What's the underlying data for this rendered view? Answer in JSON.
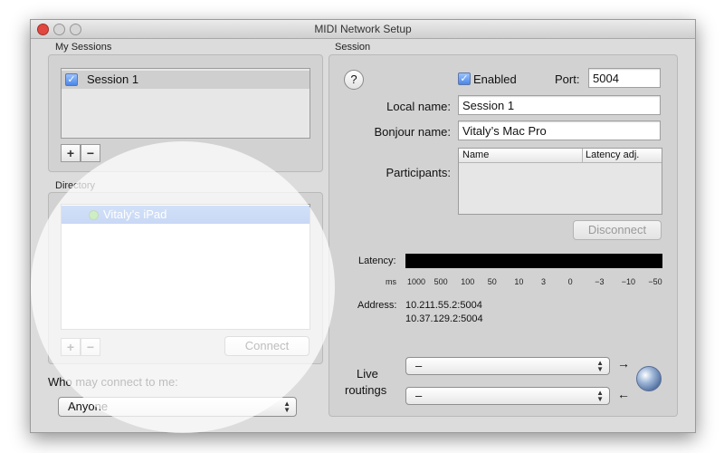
{
  "window": {
    "title": "MIDI Network Setup"
  },
  "my_sessions": {
    "label": "My Sessions",
    "items": [
      {
        "label": "Session 1",
        "checked": true
      }
    ],
    "add_label": "+",
    "remove_label": "−"
  },
  "directory": {
    "label": "Directory",
    "items": [
      {
        "label": "Vitaly’s iPad",
        "status_color": "#4fc02a"
      }
    ],
    "add_label": "+",
    "remove_label": "−",
    "connect_label": "Connect"
  },
  "who_may_connect": {
    "label": "Who may connect to me:",
    "selected": "Anyone"
  },
  "session": {
    "label": "Session",
    "help_label": "?",
    "enabled_label": "Enabled",
    "enabled": true,
    "port_label": "Port:",
    "port_value": "5004",
    "local_name_label": "Local name:",
    "local_name_value": "Session 1",
    "bonjour_name_label": "Bonjour name:",
    "bonjour_name_value": "Vitaly’s Mac Pro",
    "participants_label": "Participants:",
    "participants_columns": [
      "Name",
      "Latency adj."
    ],
    "disconnect_label": "Disconnect",
    "latency_label": "Latency:",
    "latency_unit": "ms",
    "latency_ticks": [
      "1000",
      "500",
      "100",
      "50",
      "10",
      "3",
      "0",
      "−3",
      "−10",
      "−50"
    ],
    "address_label": "Address:",
    "addresses": [
      "10.211.55.2:5004",
      "10.37.129.2:5004"
    ],
    "live_routings_label_1": "Live",
    "live_routings_label_2": "routings",
    "routing_in": "–",
    "routing_out": "–",
    "arrow_right": "→",
    "arrow_left": "←"
  },
  "colors": {
    "selection": "#3c73d9",
    "accent": "#4a86e8"
  }
}
